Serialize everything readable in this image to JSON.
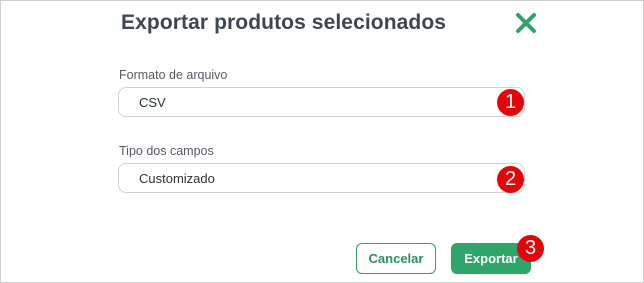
{
  "dialog": {
    "title": "Exportar produtos selecionados",
    "close_icon": "close-x-icon"
  },
  "fields": [
    {
      "label": "Formato de arquivo",
      "value": "CSV"
    },
    {
      "label": "Tipo dos campos",
      "value": "Customizado"
    }
  ],
  "badges": [
    "1",
    "2",
    "3"
  ],
  "actions": {
    "cancel_label": "Cancelar",
    "export_label": "Exportar"
  },
  "colors": {
    "accent": "#30a56a",
    "badge": "#e2060b",
    "title": "#3e4652"
  }
}
